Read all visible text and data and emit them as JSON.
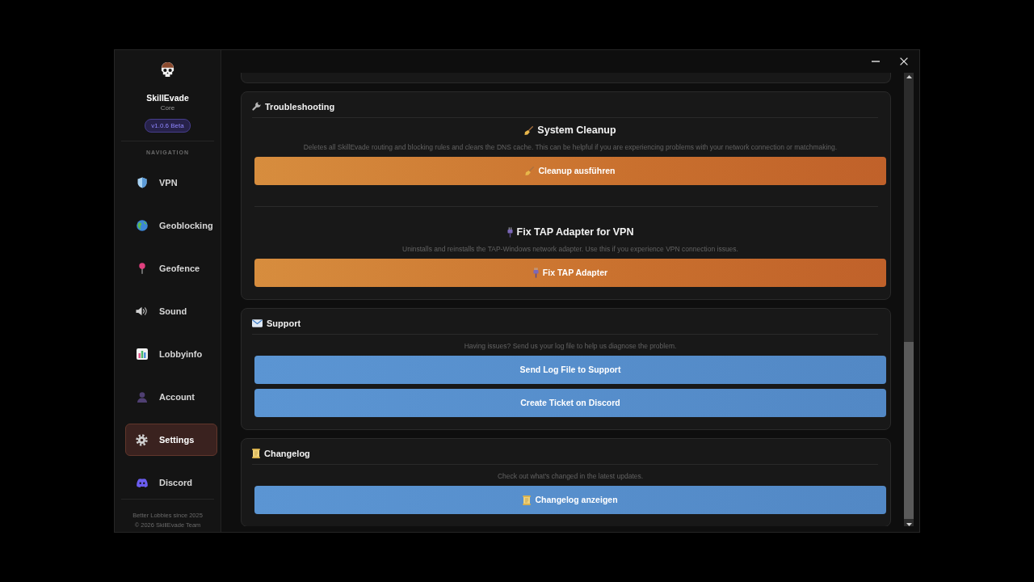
{
  "sidebar": {
    "app_name": "SkillEvade",
    "edition": "Core",
    "version": "v1.0.6 Beta",
    "section_label": "NAVIGATION",
    "items": [
      {
        "label": "VPN",
        "selected": false
      },
      {
        "label": "Geoblocking",
        "selected": false
      },
      {
        "label": "Geofence",
        "selected": false
      },
      {
        "label": "Sound",
        "selected": false
      },
      {
        "label": "Lobbyinfo",
        "selected": false
      },
      {
        "label": "Account",
        "selected": false
      },
      {
        "label": "Settings",
        "selected": true
      },
      {
        "label": "Discord",
        "selected": false
      }
    ],
    "footer": [
      "Better Lobbies since 2025",
      "© 2026 SkillEvade Team"
    ]
  },
  "sections": [
    {
      "title": "Troubleshooting",
      "blocks": [
        {
          "heading": "System Cleanup",
          "description": "Deletes all SkillEvade routing and blocking rules and clears the DNS cache. This can be helpful if you are experiencing problems with your network connection or matchmaking.",
          "buttons": [
            {
              "label": "Cleanup ausführen",
              "kind": "warning"
            }
          ]
        },
        {
          "heading": "Fix TAP Adapter for VPN",
          "description": "Uninstalls and reinstalls the TAP-Windows network adapter. Use this if you experience VPN connection issues.",
          "buttons": [
            {
              "label": "Fix TAP Adapter",
              "kind": "warning"
            }
          ]
        }
      ]
    },
    {
      "title": "Support",
      "blocks": [
        {
          "description": "Having issues? Send us your log file to help us diagnose the problem.",
          "buttons": [
            {
              "label": "Send Log File to Support",
              "kind": "primary"
            },
            {
              "label": "Create Ticket on Discord",
              "kind": "primary"
            }
          ]
        }
      ]
    },
    {
      "title": "Changelog",
      "blocks": [
        {
          "description": "Check out what's changed in the latest updates.",
          "buttons": [
            {
              "label": "Changelog anzeigen",
              "kind": "primary"
            }
          ]
        }
      ]
    }
  ]
}
